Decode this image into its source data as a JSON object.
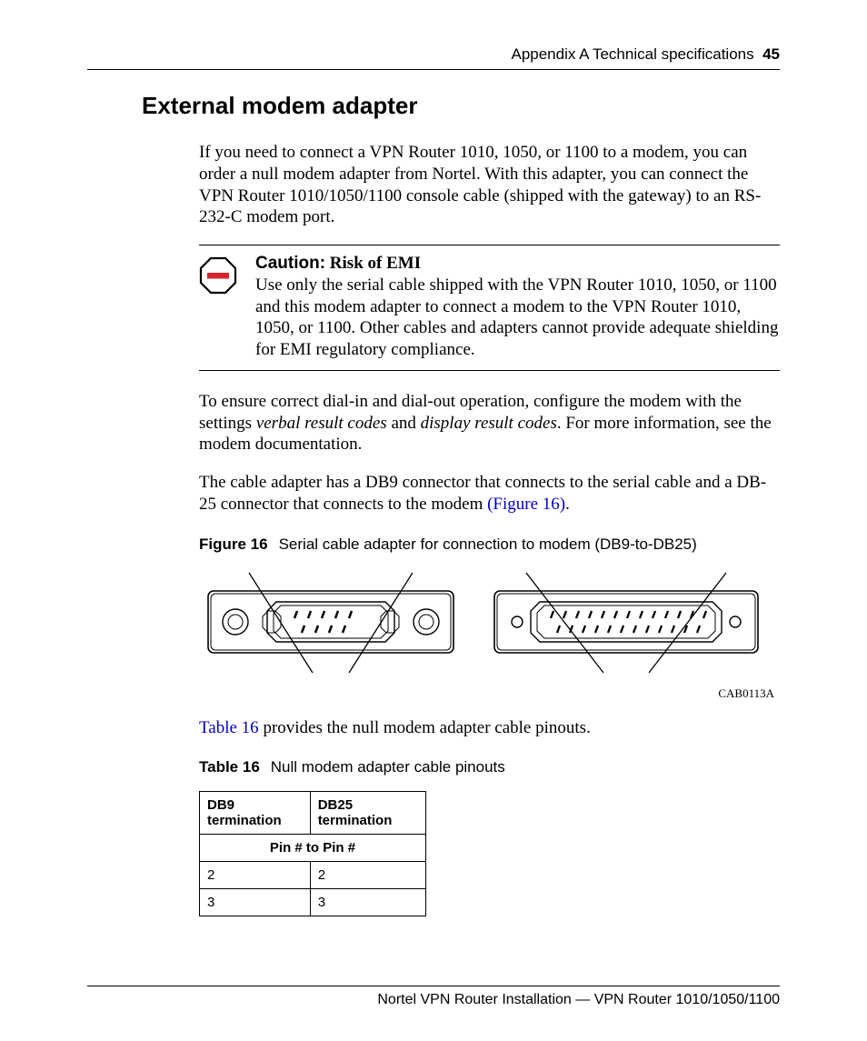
{
  "header": {
    "chapter": "Appendix A  Technical specifications",
    "page": "45"
  },
  "section_title": "External modem adapter",
  "para1": "If you need to connect a VPN Router 1010, 1050, or 1100 to a modem, you can order a null modem adapter from Nortel. With this adapter, you can connect the VPN Router 1010/1050/1100 console cable (shipped with the gateway) to an RS-232-C modem port.",
  "caution": {
    "label": "Caution:",
    "title": "Risk of EMI",
    "body": "Use only the serial cable shipped with the VPN Router 1010, 1050, or 1100 and this modem adapter to connect a modem to the VPN Router 1010, 1050, or 1100. Other cables and adapters cannot provide adequate shielding for EMI regulatory compliance."
  },
  "para2_a": "To ensure correct dial-in and dial-out operation, configure the modem with the settings ",
  "para2_i1": "verbal result codes",
  "para2_b": " and ",
  "para2_i2": "display result codes",
  "para2_c": ". For more information, see the modem documentation.",
  "para3_a": "The cable adapter has a DB9 connector that connects to the serial cable and a DB-25 connector that connects to the modem ",
  "para3_link": "(Figure 16)",
  "para3_b": ".",
  "figure": {
    "num": "Figure 16",
    "title": "Serial cable adapter for connection to modem (DB9-to-DB25)",
    "code": "CAB0113A"
  },
  "para4_link": "Table 16",
  "para4_rest": " provides the null modem adapter cable pinouts.",
  "table": {
    "num": "Table 16",
    "title": "Null modem adapter cable pinouts",
    "col1": "DB9 termination",
    "col2": "DB25 termination",
    "subhead": "Pin # to Pin #",
    "rows": [
      {
        "a": "2",
        "b": "2"
      },
      {
        "a": "3",
        "b": "3"
      }
    ]
  },
  "footer": "Nortel VPN Router Installation — VPN Router 1010/1050/1100"
}
